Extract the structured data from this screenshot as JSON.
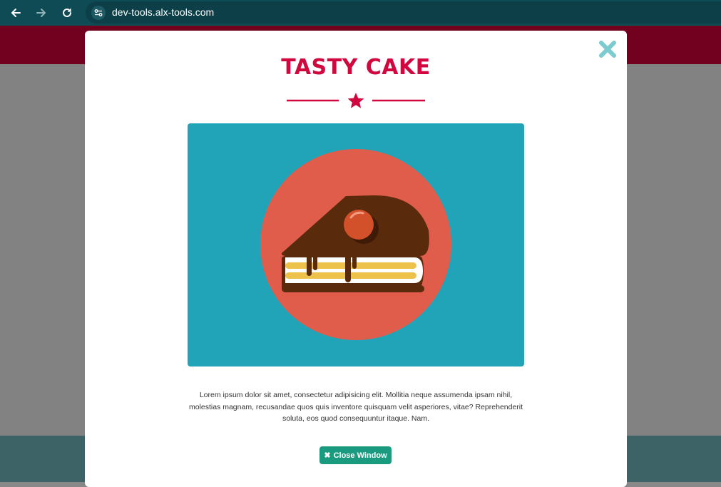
{
  "browser": {
    "url": "dev-tools.alx-tools.com"
  },
  "modal": {
    "title": "TASTY CAKE",
    "description": "Lorem ipsum dolor sit amet, consectetur adipisicing elit. Mollitia neque assumenda ipsam nihil, molestias magnam, recusandae quos quis inventore quisquam velit asperiores, vitae? Reprehenderit soluta, eos quod consequuntur itaque. Nam.",
    "close_button_label": "Close Window",
    "close_button_icon": "✖"
  },
  "colors": {
    "accent": "#d1083f",
    "button": "#1a9b80",
    "close_icon": "#7ccbcf",
    "hero_bg": "#22a4b8",
    "plate": "#e05c4b"
  },
  "icons": [
    "back-arrow-icon",
    "forward-arrow-icon",
    "reload-icon",
    "site-settings-icon",
    "close-icon",
    "star-icon",
    "cake-illustration"
  ]
}
